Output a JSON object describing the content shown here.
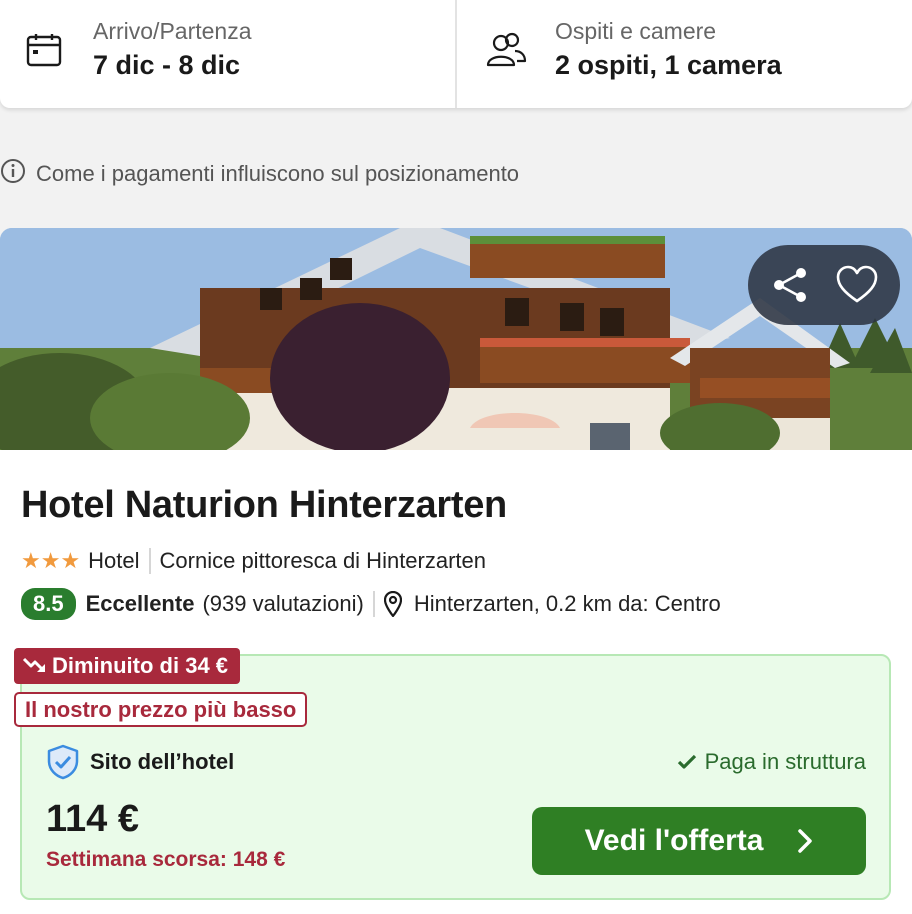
{
  "search": {
    "dates_label": "Arrivo/Partenza",
    "dates_value": "7 dic - 8 dic",
    "guests_label": "Ospiti e camere",
    "guests_value": "2 ospiti, 1 camera"
  },
  "notice": "Come i pagamenti influiscono sul posizionamento",
  "hotel": {
    "name": "Hotel Naturion Hinterzarten",
    "stars": "★★★",
    "star_count": 3,
    "type": "Hotel",
    "tagline": "Cornice pittoresca di Hinterzarten",
    "rating_score": "8.5",
    "rating_word": "Eccellente",
    "rating_count": "(939 valutazioni)",
    "location": "Hinterzarten, 0.2 km da: Centro"
  },
  "offer": {
    "price_drop_badge": "Diminuito di 34 €",
    "lowest_price_badge": "Il nostro prezzo più basso",
    "provider": "Sito dell’hotel",
    "payment_note": "Paga in struttura",
    "price": "114 €",
    "last_week": "Settimana scorsa: 148 €",
    "cta_label": "Vedi l'offerta"
  },
  "icons": {
    "calendar": "calendar-icon",
    "guests": "guests-icon",
    "info": "info-icon",
    "share": "share-icon",
    "favorite": "heart-icon",
    "location": "location-pin-icon",
    "trend_down": "trend-down-icon",
    "shield": "shield-check-icon",
    "check": "check-icon",
    "chevron": "chevron-right-icon"
  },
  "colors": {
    "rating_green": "#2a7d2e",
    "cta_green": "#2f7f24",
    "alert_red": "#a8293c",
    "star_orange": "#f19a3e",
    "offer_bg": "#eafbe9",
    "shield_blue": "#3b8ce0"
  }
}
